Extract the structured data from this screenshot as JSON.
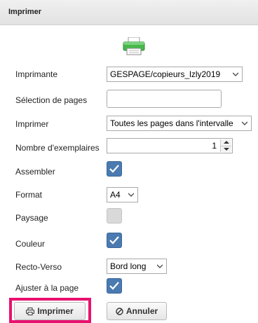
{
  "dialog": {
    "title": "Imprimer"
  },
  "labels": {
    "printer": "Imprimante",
    "page_selection": "Sélection de pages",
    "print_range": "Imprimer",
    "copies": "Nombre d'exemplaires",
    "collate": "Assembler",
    "format": "Format",
    "landscape": "Paysage",
    "color": "Couleur",
    "duplex": "Recto-Verso",
    "fit_to_page": "Ajuster à la page"
  },
  "fields": {
    "printer": "GESPAGE/copieurs_lzly2019",
    "page_selection": "",
    "print_range": "Toutes les pages dans l'intervalle",
    "copies": "1",
    "format": "A4",
    "duplex": "Bord long"
  },
  "checkboxes": {
    "collate": true,
    "landscape": false,
    "color": true,
    "fit_to_page": true
  },
  "buttons": {
    "print": "Imprimer",
    "cancel": "Annuler"
  },
  "colors": {
    "checkbox_checked": "#4a7ab0",
    "checkbox_unchecked": "#d9d9d9",
    "highlight": "#e8116f"
  }
}
